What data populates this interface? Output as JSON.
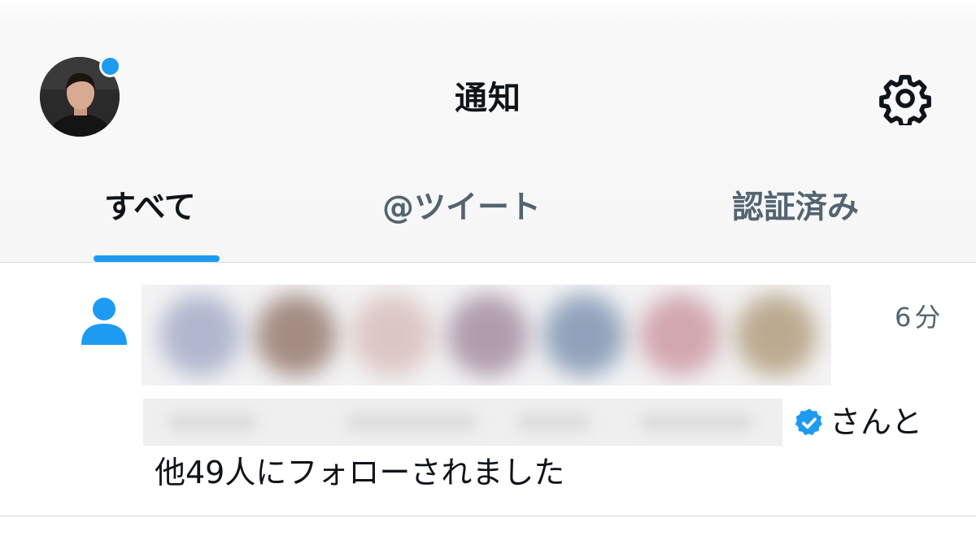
{
  "header": {
    "title": "通知",
    "profile_avatar": "user-avatar",
    "settings_icon": "gear-icon",
    "has_unread_dot": true
  },
  "tabs": [
    {
      "label": "すべて",
      "active": true
    },
    {
      "label": "@ツイート",
      "active": false
    },
    {
      "label": "認証済み",
      "active": false
    }
  ],
  "notification": {
    "icon": "person-icon",
    "time": "6分",
    "name_suffix": "さんと",
    "message": "他49人にフォローされました",
    "verified_icon": "verified-badge-icon"
  },
  "colors": {
    "accent": "#1d9bf0",
    "text_primary": "#0f1419",
    "text_secondary": "#536471",
    "divider": "#cfd9de"
  }
}
